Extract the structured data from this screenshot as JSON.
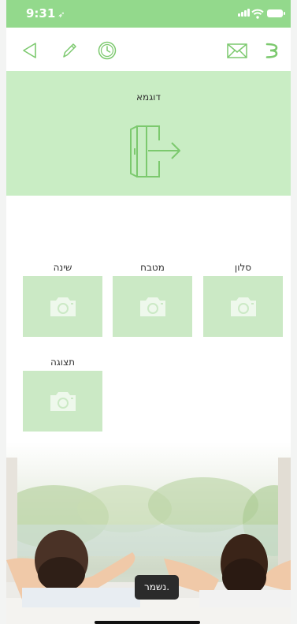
{
  "status_bar": {
    "time": "9:31"
  },
  "toolbar": {
    "left_icons": [
      "back-arrow-icon",
      "pencil-icon",
      "clock-icon"
    ],
    "right_icons": [
      "mail-icon",
      "menu-icon"
    ],
    "accent_color": "#7cc96e"
  },
  "banner": {
    "title": "דוגמא",
    "icon": "exit-door-icon",
    "background": "#c9edc4"
  },
  "rooms": [
    {
      "label": "סלון",
      "icon": "camera-icon"
    },
    {
      "label": "מטבח",
      "icon": "camera-icon"
    },
    {
      "label": "שינה",
      "icon": "camera-icon"
    },
    {
      "label": "תצוגה",
      "icon": "camera-icon"
    }
  ],
  "toast": {
    "text": "נשמר."
  }
}
